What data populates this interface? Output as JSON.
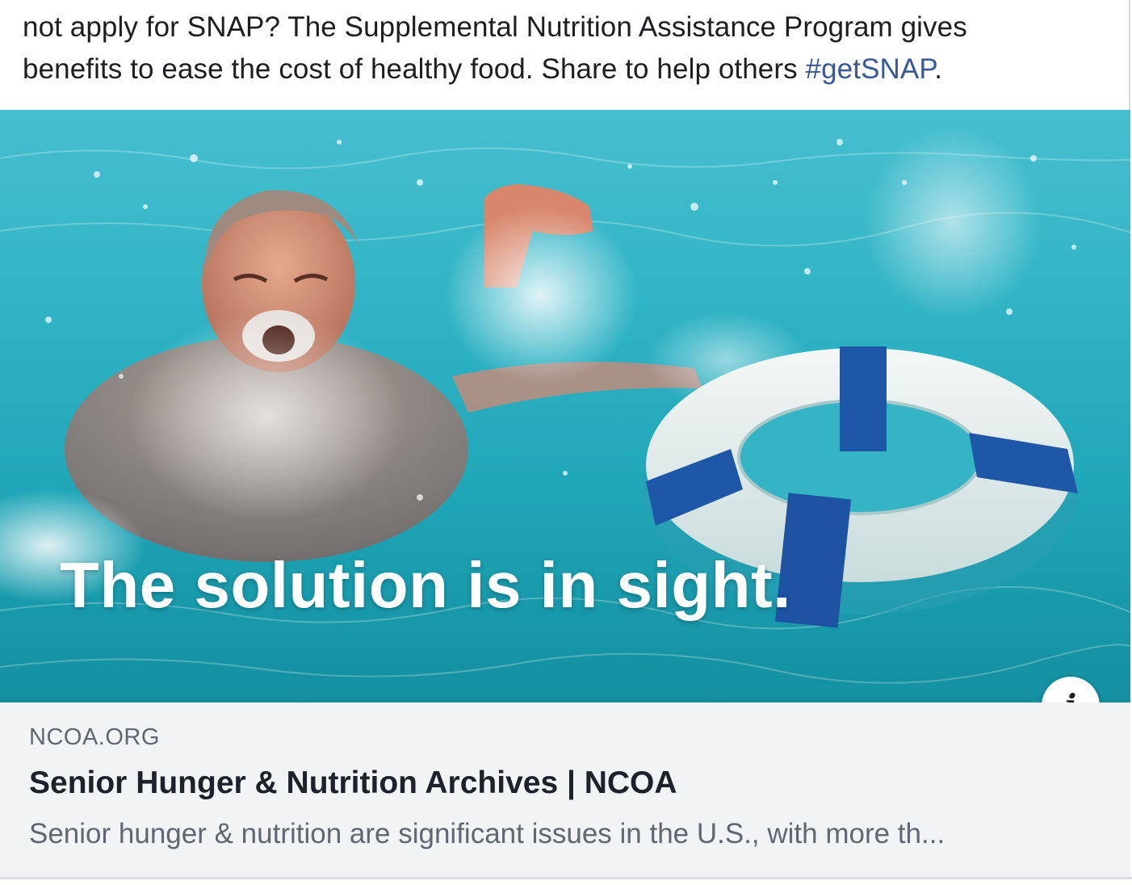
{
  "post": {
    "text_line1": "not apply for SNAP? The Supplemental Nutrition Assistance Program gives",
    "text_line2_before": "benefits to ease the cost of healthy food. Share to help others ",
    "hashtag": "#getSNAP",
    "text_line2_after": "."
  },
  "image": {
    "description_icon": "photo-drowning-man-life-ring",
    "caption": "The solution is in sight."
  },
  "info_button": {
    "glyph": "i",
    "icon": "info-icon"
  },
  "link_preview": {
    "domain": "NCOA.ORG",
    "title": "Senior Hunger & Nutrition Archives | NCOA",
    "description": "Senior hunger & nutrition are significant issues in the U.S., with more th..."
  },
  "colors": {
    "hashtag": "#385898",
    "water": "#2fb3c4",
    "ring_white": "#eef3f1",
    "ring_strap": "#1f57a8",
    "card_bg": "#f2f3f5"
  }
}
